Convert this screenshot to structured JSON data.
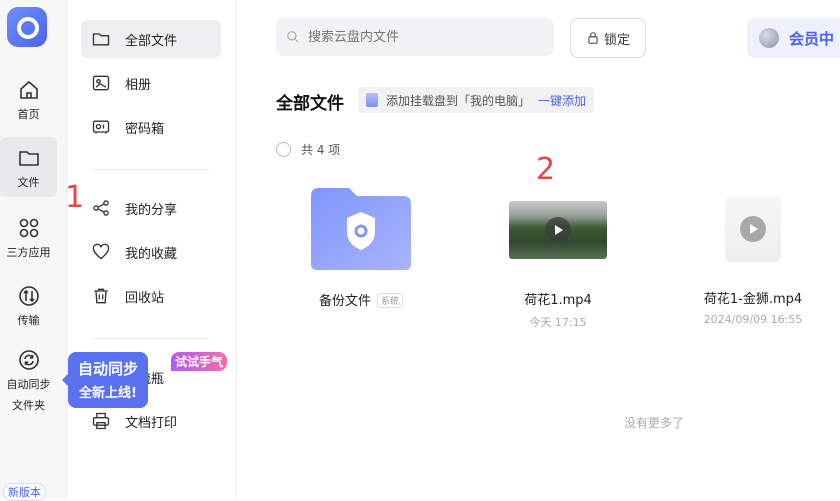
{
  "rail": {
    "items": [
      {
        "label": "首页",
        "icon": "home-icon"
      },
      {
        "label": "文件",
        "icon": "folder-icon"
      },
      {
        "label": "三方应用",
        "icon": "apps-icon"
      },
      {
        "label": "传输",
        "icon": "transfer-icon"
      },
      {
        "label": "自动同步",
        "label2": "文件夹",
        "icon": "sync-icon"
      }
    ],
    "new_version": "新版本"
  },
  "sidebar": {
    "items": [
      {
        "label": "全部文件",
        "icon": "folder-icon"
      },
      {
        "label": "相册",
        "icon": "photo-icon"
      },
      {
        "label": "密码箱",
        "icon": "safe-icon"
      },
      {
        "label": "我的分享",
        "icon": "share-icon"
      },
      {
        "label": "我的收藏",
        "icon": "heart-icon"
      },
      {
        "label": "回收站",
        "icon": "trash-icon"
      },
      {
        "label": "漂流瓶",
        "icon": "bottle-icon"
      },
      {
        "label": "文档打印",
        "icon": "printer-icon"
      }
    ],
    "tooltip": {
      "line1": "自动同步",
      "line2": "全新上线!"
    },
    "try_badge": "试试手气"
  },
  "annotations": {
    "one": "1",
    "two": "2"
  },
  "header": {
    "search_placeholder": "搜索云盘内文件",
    "lock_label": "锁定",
    "vip_label": "会员中"
  },
  "main": {
    "title": "全部文件",
    "mount_text": "添加挂载盘到「我的电脑」",
    "mount_link": "一键添加",
    "count_text": "共 4 项",
    "files": [
      {
        "name": "备份文件",
        "tag": "系统",
        "meta": ""
      },
      {
        "name": "荷花1.mp4",
        "meta": "今天 17:15"
      },
      {
        "name": "荷花1-金狮.mp4",
        "meta": "2024/09/09 16:55"
      }
    ],
    "no_more": "没有更多了"
  },
  "colors": {
    "accent": "#4a63f0",
    "annotation_red": "#e64545"
  }
}
